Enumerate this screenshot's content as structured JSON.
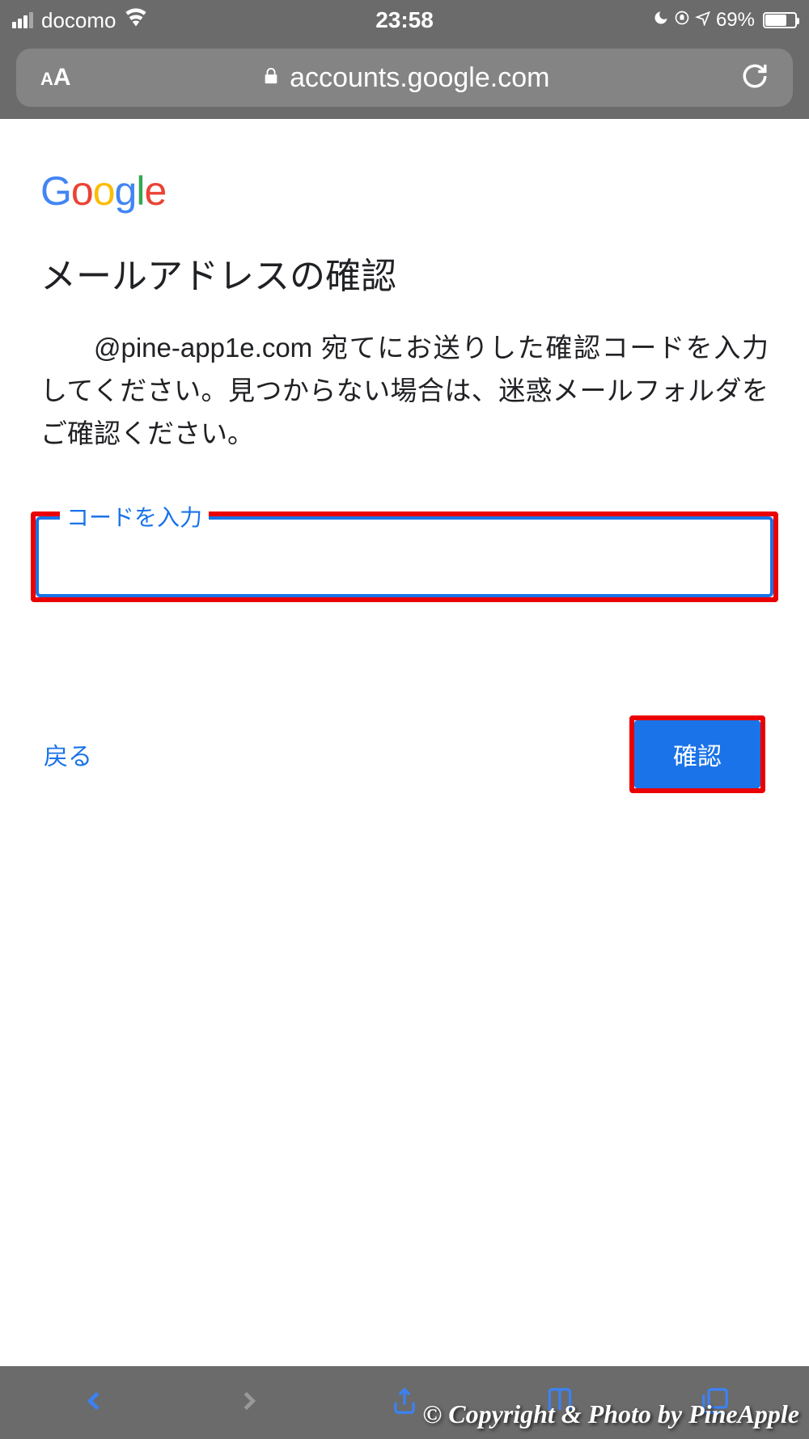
{
  "status_bar": {
    "carrier": "docomo",
    "time": "23:58",
    "battery_percent": "69%"
  },
  "address_bar": {
    "url_display": "accounts.google.com"
  },
  "page": {
    "logo_text": "Google",
    "title": "メールアドレスの確認",
    "description": "@pine-app1e.com 宛てにお送りした確認コードを入力してください。見つからない場合は、迷惑メールフォルダをご確認ください。",
    "input_label": "コードを入力",
    "back_label": "戻る",
    "confirm_label": "確認"
  },
  "footer": {
    "copyright": "© Copyright & Photo by PineApple"
  },
  "colors": {
    "highlight_red": "#EA0000",
    "google_blue": "#1a73e8"
  }
}
